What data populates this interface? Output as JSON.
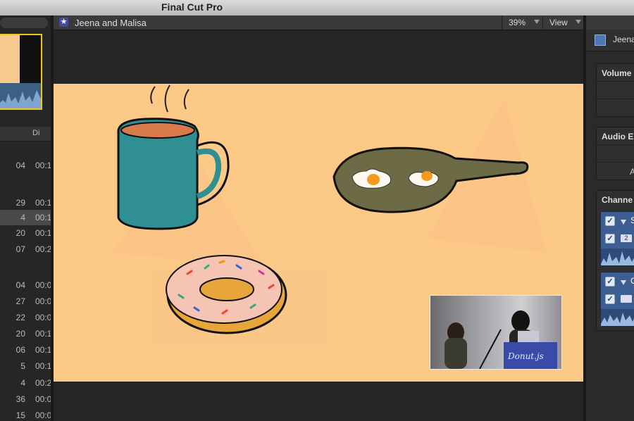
{
  "app": {
    "title": "Final Cut Pro"
  },
  "browser": {
    "column_header": "Di",
    "rows": [
      {
        "a": "04",
        "b": "00:1"
      },
      {
        "a": "29",
        "b": "00:1"
      },
      {
        "a": "4",
        "b": "00:1",
        "selected": true
      },
      {
        "a": "20",
        "b": "00:1"
      },
      {
        "a": "07",
        "b": "00:2"
      },
      {
        "a": "04",
        "b": "00:0"
      },
      {
        "a": "27",
        "b": "00:0"
      },
      {
        "a": "22",
        "b": "00:0"
      },
      {
        "a": "20",
        "b": "00:1"
      },
      {
        "a": "06",
        "b": "00:1"
      },
      {
        "a": "5",
        "b": "00:1"
      },
      {
        "a": "4",
        "b": "00:2"
      },
      {
        "a": "36",
        "b": "00:0"
      },
      {
        "a": "15",
        "b": "00:0"
      }
    ]
  },
  "viewer": {
    "title": "Jeena and Malisa",
    "zoom": "39%",
    "view_label": "View",
    "podium_text": "Donut.js"
  },
  "inspector": {
    "clip_name": "Jeena",
    "sections": {
      "volume": "Volume",
      "audio_enhancements": "Audio E",
      "audio_sub": "A",
      "channels": "Channe"
    },
    "channel_groups": [
      {
        "label": "S",
        "sub": "2"
      },
      {
        "label": "C",
        "sub": ""
      }
    ]
  },
  "colors": {
    "selection": "#e8c81c",
    "canvas": "#fcc987",
    "accent": "#3c5e92"
  }
}
